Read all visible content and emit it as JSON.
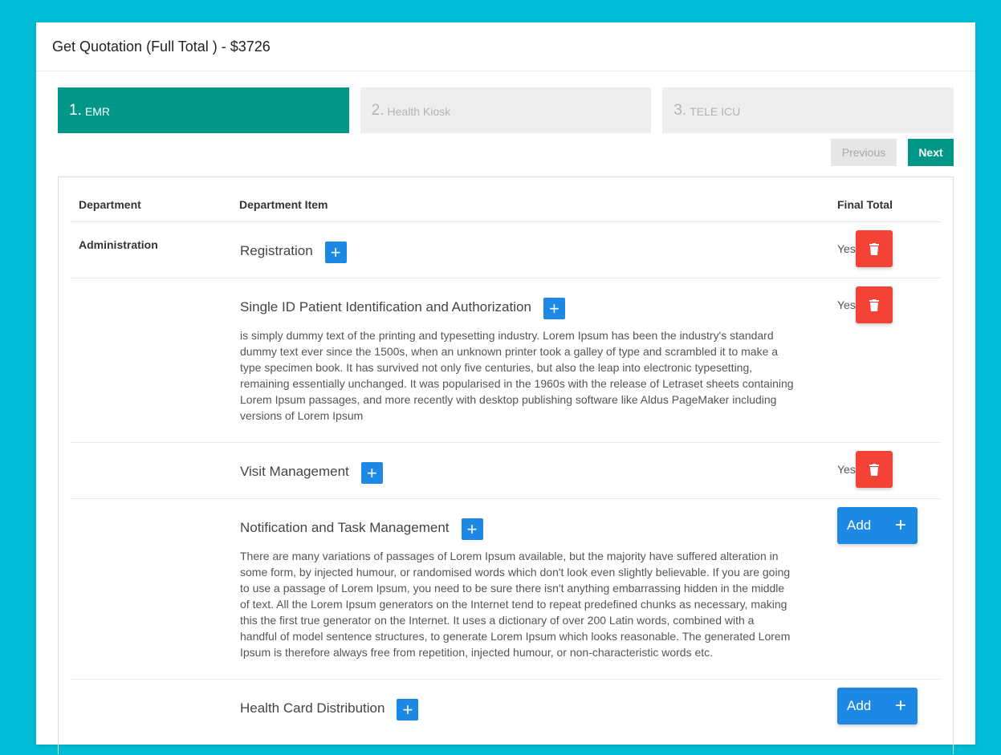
{
  "header": {
    "title": "Get Quotation (Full Total ) - $3726"
  },
  "steps": [
    {
      "num": "1.",
      "label": "EMR",
      "active": true
    },
    {
      "num": "2.",
      "label": "Health Kiosk",
      "active": false
    },
    {
      "num": "3.",
      "label": "TELE ICU",
      "active": false
    }
  ],
  "nav": {
    "previous": "Previous",
    "next": "Next"
  },
  "table": {
    "columns": {
      "department": "Department",
      "item": "Department Item",
      "final_total": "Final Total"
    },
    "rows": [
      {
        "department": "Administration",
        "item": "Registration",
        "description": "",
        "final_text": "Yes",
        "action": "delete"
      },
      {
        "department": "",
        "item": "Single ID Patient Identification and Authorization",
        "description": "is simply dummy text of the printing and typesetting industry. Lorem Ipsum has been the industry's standard dummy text ever since the 1500s, when an unknown printer took a galley of type and scrambled it to make a type specimen book. It has survived not only five centuries, but also the leap into electronic typesetting, remaining essentially unchanged. It was popularised in the 1960s with the release of Letraset sheets containing Lorem Ipsum passages, and more recently with desktop publishing software like Aldus PageMaker including versions of Lorem Ipsum",
        "final_text": "Yes",
        "action": "delete"
      },
      {
        "department": "",
        "item": "Visit Management",
        "description": "",
        "final_text": "Yes",
        "action": "delete"
      },
      {
        "department": "",
        "item": "Notification and Task Management",
        "description": "There are many variations of passages of Lorem Ipsum available, but the majority have suffered alteration in some form, by injected humour, or randomised words which don't look even slightly believable. If you are going to use a passage of Lorem Ipsum, you need to be sure there isn't anything embarrassing hidden in the middle of text. All the Lorem Ipsum generators on the Internet tend to repeat predefined chunks as necessary, making this the first true generator on the Internet. It uses a dictionary of over 200 Latin words, combined with a handful of model sentence structures, to generate Lorem Ipsum which looks reasonable. The generated Lorem Ipsum is therefore always free from repetition, injected humour, or non-characteristic words etc.",
        "final_text": "",
        "action": "add"
      },
      {
        "department": "",
        "item": "Health Card Distribution",
        "description": "",
        "final_text": "",
        "action": "add"
      }
    ],
    "add_label": "Add",
    "plus_glyph": "+",
    "icons": {
      "row_add": "plus-icon",
      "delete": "trash-icon",
      "add": "plus-icon"
    }
  },
  "colors": {
    "background": "#00bcd4",
    "step_active": "#009688",
    "step_inactive": "#eeeeee",
    "primary_button": "#1e88e5",
    "delete_button": "#f44336"
  }
}
